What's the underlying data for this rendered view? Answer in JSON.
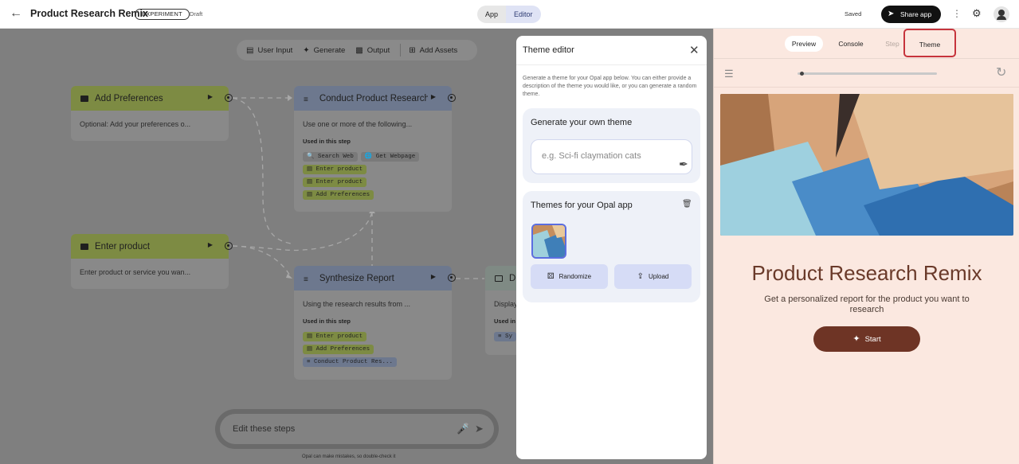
{
  "header": {
    "back_icon": "arrow-left-icon",
    "title": "Product Research Remix",
    "badge": "EXPERIMENT",
    "status": "Draft",
    "modes": [
      "App",
      "Editor"
    ],
    "active_mode": "Editor",
    "saved": "Saved",
    "share_label": "Share app"
  },
  "toolbar": {
    "items": [
      "User Input",
      "Generate",
      "Output",
      "Add Assets"
    ]
  },
  "nodes": {
    "add_preferences": {
      "title": "Add Preferences",
      "desc": "Optional: Add your preferences o..."
    },
    "conduct_research": {
      "title": "Conduct Product Research",
      "desc": "Use one or more of the following...",
      "used_label": "Used in this step",
      "chips": [
        "Search Web",
        "Get Webpage",
        "Enter product",
        "Enter product",
        "Add Preferences"
      ]
    },
    "enter_product": {
      "title": "Enter product",
      "desc": "Enter product or service you wan..."
    },
    "synthesize": {
      "title": "Synthesize Report",
      "desc": "Using the research results from ...",
      "used_label": "Used in this step",
      "chips": [
        "Enter product",
        "Add Preferences",
        "Conduct Product Res..."
      ]
    },
    "display": {
      "title": "Di",
      "desc": "Display",
      "used_label": "Used in",
      "chips": [
        "Sy"
      ]
    }
  },
  "chat": {
    "placeholder": "Edit these steps",
    "disclaimer": "Opal can make mistakes, so double-check it"
  },
  "theme_editor": {
    "title": "Theme editor",
    "description": "Generate a theme for your Opal app below. You can either provide a description of the theme you would like, or you can generate a random theme.",
    "generate_title": "Generate your own theme",
    "input_placeholder": "e.g. Sci-fi claymation cats",
    "themes_title": "Themes for your Opal app",
    "randomize_label": "Randomize",
    "upload_label": "Upload"
  },
  "preview": {
    "tabs": [
      "Preview",
      "Console",
      "Step",
      "Theme"
    ],
    "active_tab": "Theme",
    "app_title": "Product Research Remix",
    "app_subtitle": "Get a personalized report for the product you want to research",
    "start_label": "Start",
    "progress": 0.02
  },
  "colors": {
    "accent_dark": "#6e3425",
    "theme_highlight": "#c6343c",
    "preview_bg": "#fbe8e0"
  }
}
